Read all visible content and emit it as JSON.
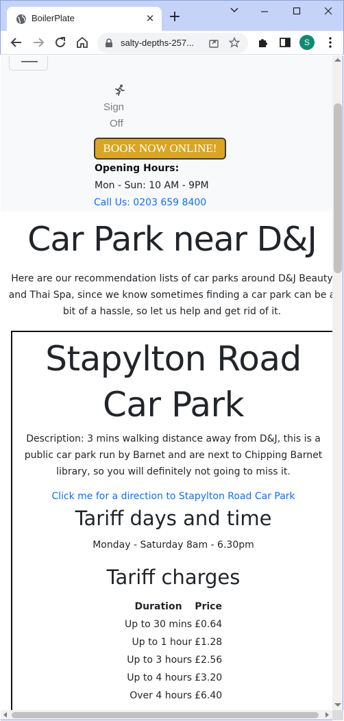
{
  "browser": {
    "tab_title": "BoilerPlate",
    "url": "salty-depths-257...",
    "profile_initial": "S"
  },
  "header": {
    "sign_off_line1": "Sign",
    "sign_off_line2": "Off",
    "book_button": "BOOK NOW ONLINE!",
    "hours_title": "Opening Hours:",
    "hours_text": "Mon - Sun: 10 AM - 9PM",
    "call_link": "Call Us: 0203 659 8400"
  },
  "main": {
    "title": "Car Park near D&J",
    "intro": "Here are our recommendation lists of car parks around D&J Beauty and Thai Spa, since we know sometimes finding a car park can be a bit of a hassle, so let us help and get rid of it."
  },
  "car_park": {
    "title": "Stapylton Road Car Park",
    "description": "Description: 3 mins walking distance away from D&J, this is a public car park run by Barnet and are next to Chipping Barnet library, so you will definitely not going to miss it.",
    "direction_link": "Click me for a direction to Stapylton Road Car Park",
    "tariff_days_heading": "Tariff days and time",
    "tariff_days_text": "Monday - Saturday 8am - 6.30pm",
    "tariff_charges_heading": "Tariff charges",
    "table_headers": {
      "duration": "Duration",
      "price": "Price"
    },
    "rows": [
      {
        "duration": "Up to 30 mins",
        "price": "£0.64"
      },
      {
        "duration": "Up to 1 hour",
        "price": "£1.28"
      },
      {
        "duration": "Up to 3 hours",
        "price": "£2.56"
      },
      {
        "duration": "Up to 4 hours",
        "price": "£3.20"
      },
      {
        "duration": "Over 4 hours",
        "price": "£6.40"
      }
    ]
  },
  "colors": {
    "book_button": "#daa520",
    "link": "#0d6efd",
    "titlebar": "#c5d3f8",
    "avatar": "#0f8a73"
  }
}
